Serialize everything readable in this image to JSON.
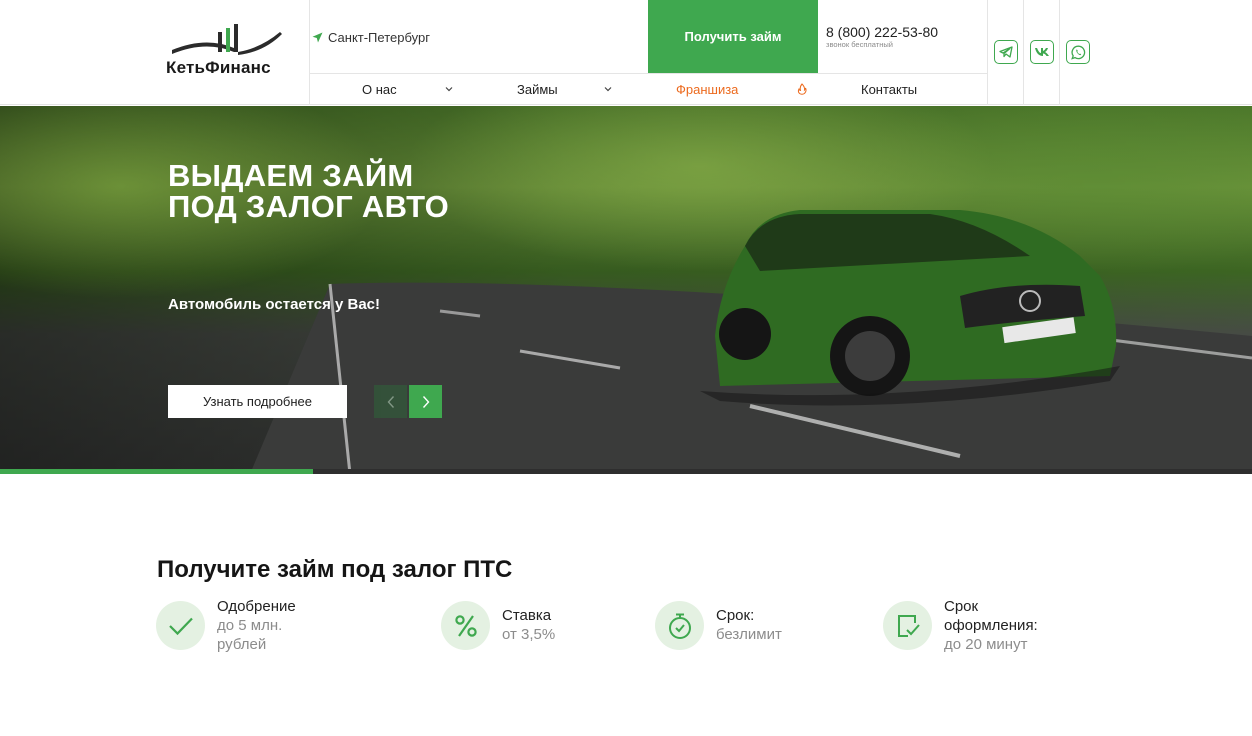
{
  "header": {
    "logo_text": "КетьФинанс",
    "city": "Санкт-Петербург",
    "cta_label": "Получить займ",
    "phone": "8 (800) 222-53-80",
    "phone_note": "звонок бесплатный",
    "social": [
      {
        "name": "telegram",
        "icon": "telegram-icon"
      },
      {
        "name": "vk",
        "icon": "vk-icon"
      },
      {
        "name": "whatsapp",
        "icon": "whatsapp-icon"
      }
    ],
    "nav": [
      {
        "label": "О нас",
        "has_dropdown": true
      },
      {
        "label": "Займы",
        "has_dropdown": true
      },
      {
        "label": "Франшиза",
        "icon": "fire-icon"
      },
      {
        "label": "Контакты"
      }
    ]
  },
  "hero": {
    "title_line1": "ВЫДАЕМ ЗАЙМ",
    "title_line2": "ПОД ЗАЛОГ АВТО",
    "subtitle": "Автомобиль остается у Вас!",
    "button_label": "Узнать подробнее",
    "slide_progress": 0.25
  },
  "features": {
    "title": "Получите займ под залог ПТС",
    "items": [
      {
        "icon": "check-icon",
        "head": [
          "Одобрение"
        ],
        "value": [
          "до 5 млн.",
          "рублей"
        ]
      },
      {
        "icon": "percent-icon",
        "head": [
          "Ставка"
        ],
        "value": [
          "от 3,5%"
        ]
      },
      {
        "icon": "stopwatch-icon",
        "head": [
          "Срок:"
        ],
        "value": [
          "безлимит"
        ]
      },
      {
        "icon": "document-check-icon",
        "head": [
          "Срок",
          "оформления:"
        ],
        "value": [
          "до 20 минут"
        ]
      }
    ]
  },
  "colors": {
    "accent": "#3fa84f",
    "nav_highlight": "#ec6a1e",
    "icon_bg": "#e4f1e2"
  }
}
